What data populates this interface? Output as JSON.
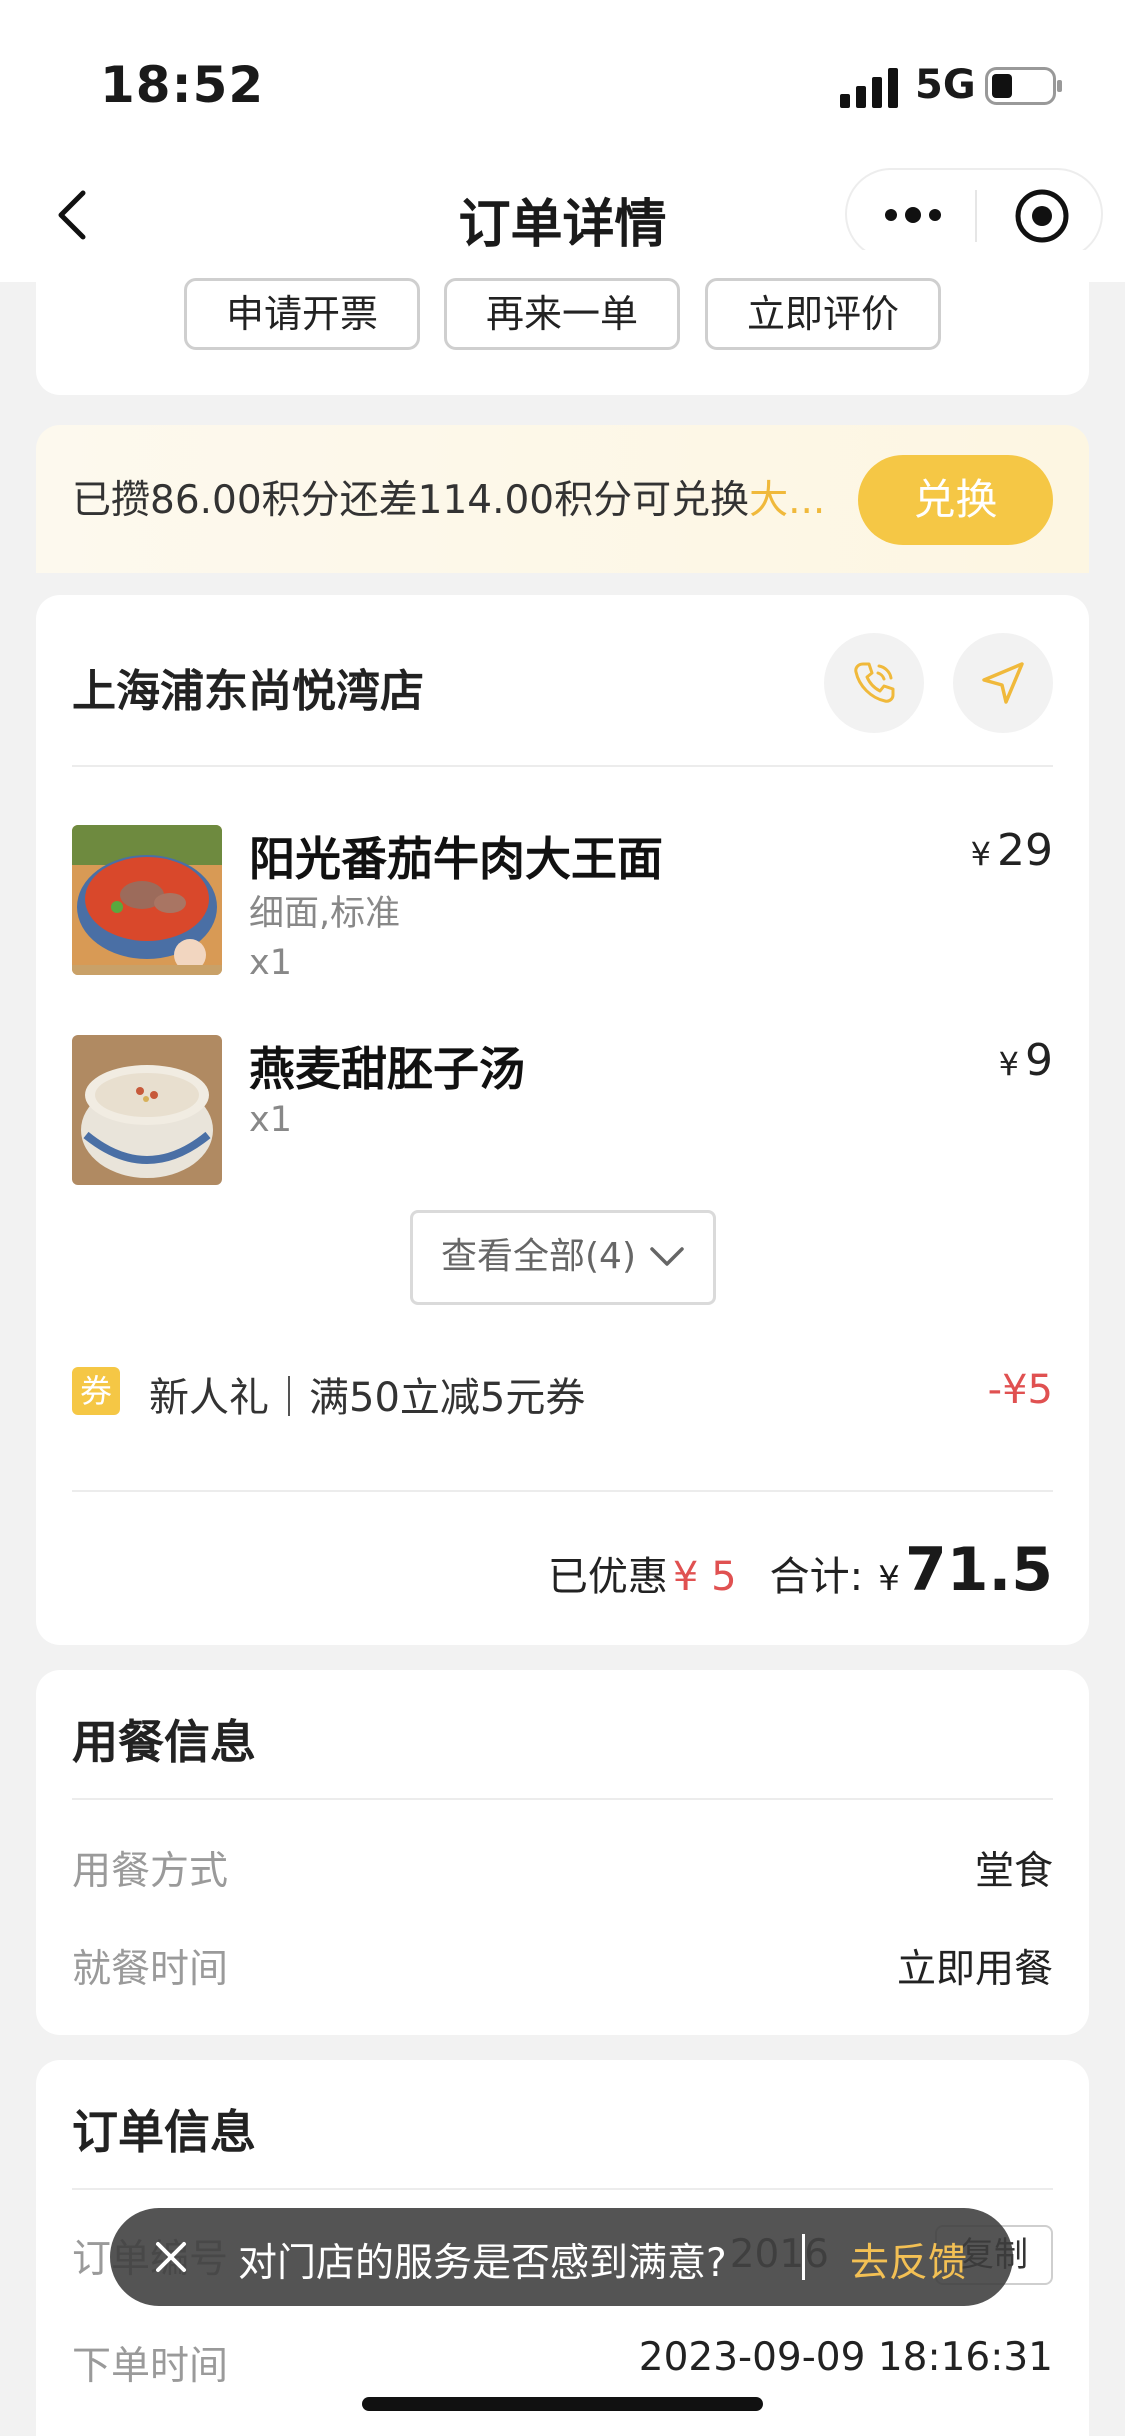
{
  "status_bar": {
    "time": "18:52",
    "network": "5G"
  },
  "nav": {
    "title": "订单详情"
  },
  "top_actions": [
    "申请开票",
    "再来一单",
    "立即评价"
  ],
  "points": {
    "text_prefix": "已攒86.00积分还差114.00积分可兑换",
    "text_highlight": "大...",
    "button": "兑换"
  },
  "store": {
    "name": "上海浦东尚悦湾店"
  },
  "items": [
    {
      "name": "阳光番茄牛肉大王面",
      "spec": "细面,标准",
      "qty": "x1",
      "price": "29"
    },
    {
      "name": "燕麦甜胚子汤",
      "spec": "",
      "qty": "x1",
      "price": "9"
    }
  ],
  "currency": "¥",
  "view_all": "查看全部(4)",
  "coupon": {
    "badge": "券",
    "text": "新人礼｜满50立减5元券",
    "value": "-¥5"
  },
  "summary": {
    "discount_label": "已优惠",
    "discount_value": "¥ 5",
    "total_label": "合计:",
    "total": "71.5"
  },
  "dining_info": {
    "title": "用餐信息",
    "rows": [
      {
        "label": "用餐方式",
        "value": "堂食"
      },
      {
        "label": "就餐时间",
        "value": "立即用餐"
      }
    ]
  },
  "order_info": {
    "title": "订单信息",
    "order_no_label": "订单编号",
    "order_no_partial": "2016",
    "copy": "复制",
    "time_label": "下单时间",
    "time_value": "2023-09-09 18:16:31"
  },
  "toast": {
    "message": "对门店的服务是否感到满意?",
    "action": "去反馈"
  }
}
